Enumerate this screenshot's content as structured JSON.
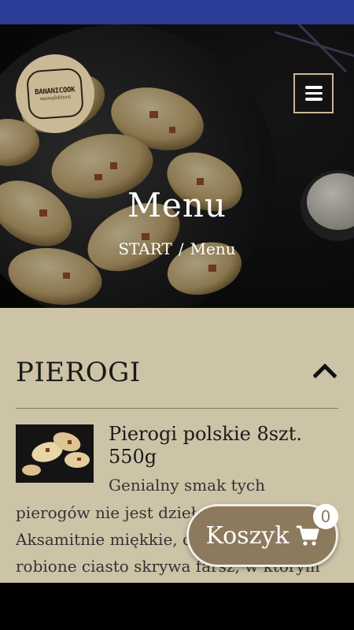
{
  "brand": {
    "logo_name": "BANANICOOK",
    "logo_sub": "manufaktura"
  },
  "header": {
    "menu_icon": "hamburger-icon"
  },
  "hero": {
    "title": "Menu",
    "breadcrumb_home": "START",
    "breadcrumb_sep": "/",
    "breadcrumb_current": "Menu"
  },
  "section": {
    "title": "PIEROGI",
    "toggle_icon": "chevron-up-icon"
  },
  "item": {
    "title": "Pierogi polskie 8szt. 550g",
    "desc_line1": "Genialny smak tych",
    "desc_line2": "pierogów nie jest dziełem przypadku.",
    "desc_line3": "Aksamitnie miękkie, cienko",
    "desc_line4": "robione ciasto skrywa farsz, w którym"
  },
  "cart": {
    "label": "Koszyk",
    "count": "0",
    "icon": "cart-icon"
  },
  "colors": {
    "accent": "#8b7a5e",
    "content_bg": "#cdc3a7",
    "status_bar": "#2b3d96",
    "logo_bg": "#c9b994"
  }
}
